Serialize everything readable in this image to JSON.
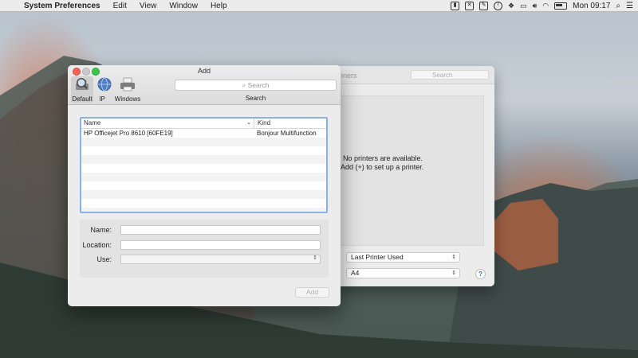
{
  "menubar": {
    "app_name": "System Preferences",
    "items": [
      "Edit",
      "View",
      "Window",
      "Help"
    ],
    "clock": "Mon 09:17"
  },
  "back_window": {
    "title_fragment": "nners",
    "search_placeholder": "Search",
    "empty_message_line1": "No printers are available.",
    "empty_message_line2": "ck Add (+) to set up a printer.",
    "default_printer_value": "Last Printer Used",
    "paper_size_value": "A4",
    "help_label": "?"
  },
  "add_window": {
    "title": "Add",
    "toolbar": [
      {
        "label": "Default",
        "icon": "magnifier-printer-icon"
      },
      {
        "label": "IP",
        "icon": "globe-icon"
      },
      {
        "label": "Windows",
        "icon": "printer-icon"
      }
    ],
    "search_placeholder": "Search",
    "search_label": "Search",
    "table": {
      "columns": [
        "Name",
        "Kind"
      ],
      "rows": [
        {
          "name": "HP Officejet Pro 8610 [60FE19]",
          "kind": "Bonjour Multifunction"
        }
      ]
    },
    "form": {
      "name_label": "Name:",
      "location_label": "Location:",
      "use_label": "Use:"
    },
    "add_button": "Add"
  },
  "colors": {
    "accent_focus": "#8ab2e8",
    "close": "#fc5f57",
    "zoom": "#34c84a"
  }
}
